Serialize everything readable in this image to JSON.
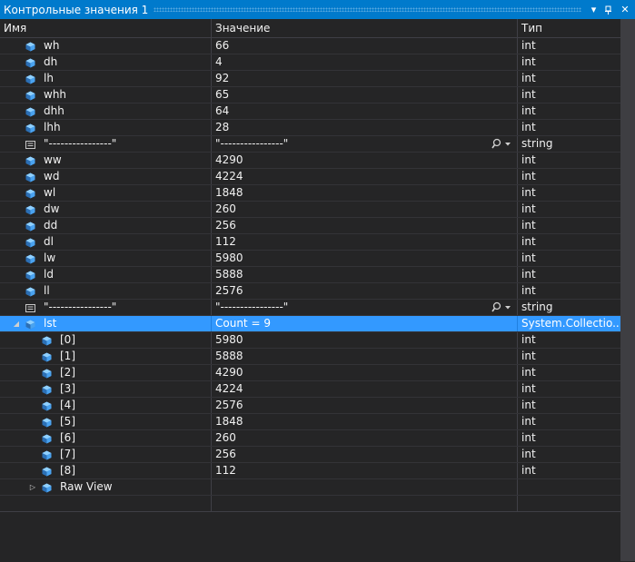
{
  "window": {
    "title": "Контрольные значения 1"
  },
  "columns": {
    "name": "Имя",
    "value": "Значение",
    "type": "Тип"
  },
  "rows": [
    {
      "name": "wh",
      "value": "66",
      "type": "int",
      "icon": "field-icon",
      "indent": 0
    },
    {
      "name": "dh",
      "value": "4",
      "type": "int",
      "icon": "field-icon",
      "indent": 0
    },
    {
      "name": "lh",
      "value": "92",
      "type": "int",
      "icon": "field-icon",
      "indent": 0
    },
    {
      "name": "whh",
      "value": "65",
      "type": "int",
      "icon": "field-icon",
      "indent": 0
    },
    {
      "name": "dhh",
      "value": "64",
      "type": "int",
      "icon": "field-icon",
      "indent": 0
    },
    {
      "name": "lhh",
      "value": "28",
      "type": "int",
      "icon": "field-icon",
      "indent": 0
    },
    {
      "name": "\"----------------\"",
      "value": "\"----------------\"",
      "type": "string",
      "icon": "string-icon",
      "indent": 0,
      "visualizer": true
    },
    {
      "name": "ww",
      "value": "4290",
      "type": "int",
      "icon": "field-icon",
      "indent": 0
    },
    {
      "name": "wd",
      "value": "4224",
      "type": "int",
      "icon": "field-icon",
      "indent": 0
    },
    {
      "name": "wl",
      "value": "1848",
      "type": "int",
      "icon": "field-icon",
      "indent": 0
    },
    {
      "name": "dw",
      "value": "260",
      "type": "int",
      "icon": "field-icon",
      "indent": 0
    },
    {
      "name": "dd",
      "value": "256",
      "type": "int",
      "icon": "field-icon",
      "indent": 0
    },
    {
      "name": "dl",
      "value": "112",
      "type": "int",
      "icon": "field-icon",
      "indent": 0
    },
    {
      "name": "lw",
      "value": "5980",
      "type": "int",
      "icon": "field-icon",
      "indent": 0
    },
    {
      "name": "ld",
      "value": "5888",
      "type": "int",
      "icon": "field-icon",
      "indent": 0
    },
    {
      "name": "ll",
      "value": "2576",
      "type": "int",
      "icon": "field-icon",
      "indent": 0
    },
    {
      "name": "\"----------------\"",
      "value": "\"----------------\"",
      "type": "string",
      "icon": "string-icon",
      "indent": 0,
      "visualizer": true
    },
    {
      "name": "lst",
      "value": "Count = 9",
      "type": "System.Collectio...",
      "icon": "field-icon",
      "indent": 0,
      "expander": "expanded",
      "selected": true
    },
    {
      "name": "[0]",
      "value": "5980",
      "type": "int",
      "icon": "field-icon",
      "indent": 1
    },
    {
      "name": "[1]",
      "value": "5888",
      "type": "int",
      "icon": "field-icon",
      "indent": 1
    },
    {
      "name": "[2]",
      "value": "4290",
      "type": "int",
      "icon": "field-icon",
      "indent": 1
    },
    {
      "name": "[3]",
      "value": "4224",
      "type": "int",
      "icon": "field-icon",
      "indent": 1
    },
    {
      "name": "[4]",
      "value": "2576",
      "type": "int",
      "icon": "field-icon",
      "indent": 1
    },
    {
      "name": "[5]",
      "value": "1848",
      "type": "int",
      "icon": "field-icon",
      "indent": 1
    },
    {
      "name": "[6]",
      "value": "260",
      "type": "int",
      "icon": "field-icon",
      "indent": 1
    },
    {
      "name": "[7]",
      "value": "256",
      "type": "int",
      "icon": "field-icon",
      "indent": 1
    },
    {
      "name": "[8]",
      "value": "112",
      "type": "int",
      "icon": "field-icon",
      "indent": 1
    },
    {
      "name": "Raw View",
      "value": "",
      "type": "",
      "icon": "field-icon",
      "indent": 1,
      "expander": "collapsed"
    },
    {
      "name": "",
      "value": "",
      "type": "",
      "icon": "",
      "indent": 0,
      "empty": true
    }
  ],
  "colors": {
    "title_bar": "#007acc",
    "background": "#252526",
    "selection": "#3399ff",
    "icon_blue": "#4aa3f0",
    "grid_line": "#3f3f46"
  }
}
